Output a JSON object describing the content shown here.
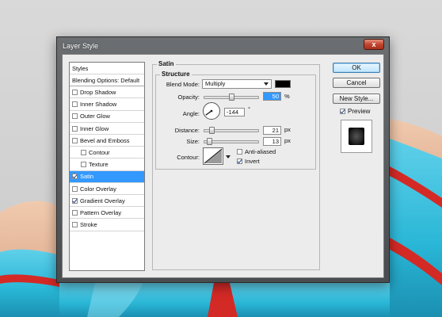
{
  "window": {
    "title": "Layer Style",
    "close_glyph": "x"
  },
  "styles_panel": {
    "items": [
      {
        "label": "Styles",
        "checkbox": false,
        "checked": false,
        "indent": 0,
        "selected": false
      },
      {
        "label": "Blending Options: Default",
        "checkbox": false,
        "checked": false,
        "indent": 0,
        "selected": false
      },
      {
        "label": "Drop Shadow",
        "checkbox": true,
        "checked": false,
        "indent": 0,
        "selected": false
      },
      {
        "label": "Inner Shadow",
        "checkbox": true,
        "checked": false,
        "indent": 0,
        "selected": false
      },
      {
        "label": "Outer Glow",
        "checkbox": true,
        "checked": false,
        "indent": 0,
        "selected": false
      },
      {
        "label": "Inner Glow",
        "checkbox": true,
        "checked": false,
        "indent": 0,
        "selected": false
      },
      {
        "label": "Bevel and Emboss",
        "checkbox": true,
        "checked": false,
        "indent": 0,
        "selected": false
      },
      {
        "label": "Contour",
        "checkbox": true,
        "checked": false,
        "indent": 1,
        "selected": false
      },
      {
        "label": "Texture",
        "checkbox": true,
        "checked": false,
        "indent": 1,
        "selected": false
      },
      {
        "label": "Satin",
        "checkbox": true,
        "checked": true,
        "indent": 0,
        "selected": true
      },
      {
        "label": "Color Overlay",
        "checkbox": true,
        "checked": false,
        "indent": 0,
        "selected": false
      },
      {
        "label": "Gradient Overlay",
        "checkbox": true,
        "checked": true,
        "indent": 0,
        "selected": false
      },
      {
        "label": "Pattern Overlay",
        "checkbox": true,
        "checked": false,
        "indent": 0,
        "selected": false
      },
      {
        "label": "Stroke",
        "checkbox": true,
        "checked": false,
        "indent": 0,
        "selected": false
      }
    ]
  },
  "satin": {
    "group_title": "Satin",
    "structure_title": "Structure",
    "blend_mode": {
      "label": "Blend Mode:",
      "value": "Multiply",
      "color": "#000000"
    },
    "opacity": {
      "label": "Opacity:",
      "value": "50",
      "unit": "%",
      "fraction": 0.5
    },
    "angle": {
      "label": "Angle:",
      "value": "-144",
      "unit": "°",
      "degrees": -144
    },
    "distance": {
      "label": "Distance:",
      "value": "21",
      "unit": "px",
      "fraction": 0.1
    },
    "size": {
      "label": "Size:",
      "value": "13",
      "unit": "px",
      "fraction": 0.05
    },
    "contour": {
      "label": "Contour:",
      "anti_aliased": {
        "label": "Anti-aliased",
        "checked": false
      },
      "invert": {
        "label": "Invert",
        "checked": true
      }
    }
  },
  "buttons": {
    "ok": "OK",
    "cancel": "Cancel",
    "new_style": "New Style..."
  },
  "preview": {
    "label": "Preview",
    "checked": true
  },
  "colors": {
    "selection": "#3399ff",
    "artwork_cyan": "#29b6d6",
    "artwork_red": "#d42a26",
    "artwork_skin": "#e8b99c"
  }
}
